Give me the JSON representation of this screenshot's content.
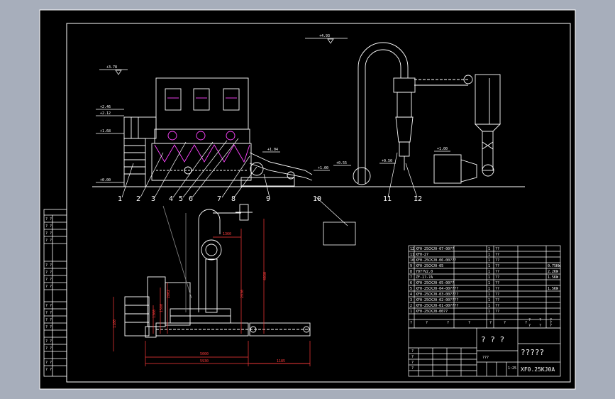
{
  "colors": {
    "background": "#a7aebb",
    "canvas": "#000000",
    "line": "#ffffff",
    "dimension": "#ff3b3b",
    "equipment": "#ff44ff",
    "secondary": "#8a8a8a"
  },
  "elevations": {
    "e1": "+4.93",
    "e2": "+3.78",
    "e3": "+2.46",
    "e4": "+2.12",
    "e5": "+1.68",
    "e6": "+0.00",
    "e7": "+1.04",
    "e8": "+1.00",
    "e9": "+0.55",
    "e10": "+0.50",
    "e11": "+1.00"
  },
  "callouts": [
    "1",
    "2",
    "3",
    "4",
    "5",
    "6",
    "7",
    "8",
    "9",
    "10",
    "11",
    "12"
  ],
  "dimensions": {
    "d1": "1360",
    "d2": "4030",
    "d3": "2930",
    "d4": "2862",
    "d5": "1580",
    "d6": "1360",
    "d7": "1180",
    "d8": "5000",
    "d9": "5930",
    "d10": "1185"
  },
  "parts_table": [
    {
      "no": "12",
      "code": "XF0-25CKJ0-07-00??",
      "qty": "1",
      "mat": "??",
      "note": ""
    },
    {
      "no": "11",
      "code": "XF0-2?",
      "qty": "1",
      "mat": "??",
      "note": ""
    },
    {
      "no": "10",
      "code": "XF0-25CKJ0-06-00???",
      "qty": "1",
      "mat": "??",
      "note": ""
    },
    {
      "no": "9",
      "code": "XF0-25CKJ0-05",
      "qty": "1",
      "mat": "??",
      "note": "0.75KW"
    },
    {
      "no": "8",
      "code": "Y07?V2.0",
      "qty": "1",
      "mat": "??",
      "note": "2.2KW"
    },
    {
      "no": "7",
      "code": "ZF-1?-?A",
      "qty": "1",
      "mat": "??",
      "note": "1.5KW"
    },
    {
      "no": "6",
      "code": "XF0-25CKJ0-05-00??",
      "qty": "1",
      "mat": "??",
      "note": ""
    },
    {
      "no": "5",
      "code": "XF0-25CKJ0-04-00????",
      "qty": "1",
      "mat": "??",
      "note": "1.5KW"
    },
    {
      "no": "4",
      "code": "XF0-25CKJ0-03-00????",
      "qty": "1",
      "mat": "??",
      "note": ""
    },
    {
      "no": "3",
      "code": "XF0-25CKJ0-02-00????",
      "qty": "1",
      "mat": "??",
      "note": ""
    },
    {
      "no": "2",
      "code": "XF0-25CKJ0-01-00????",
      "qty": "1",
      "mat": "??",
      "note": ""
    },
    {
      "no": "1",
      "code": "XF0-25CKJ0-00??",
      "qty": "1",
      "mat": "??",
      "note": ""
    }
  ],
  "parts_header": [
    "?",
    "?",
    "?",
    "?",
    "?",
    "?",
    "?",
    "?"
  ],
  "title_block": {
    "name": "? ? ?",
    "company": "?????",
    "code": "XF0.25KJ0A",
    "scale": "1:25",
    "sheet": "???",
    "rev_cells": [
      "?",
      "?",
      "?",
      "?"
    ]
  },
  "left_strip": [
    "? ?",
    "? ?",
    "? ?",
    "? ?",
    "? ?",
    "? ?",
    "? ?",
    "? ?",
    "? ?",
    "? ?",
    "? ?",
    "? ?",
    "? ?",
    "? ?",
    "? ?",
    "? ?"
  ],
  "frame_marks": [
    "?",
    "?",
    "?",
    "?",
    "?",
    "?"
  ]
}
